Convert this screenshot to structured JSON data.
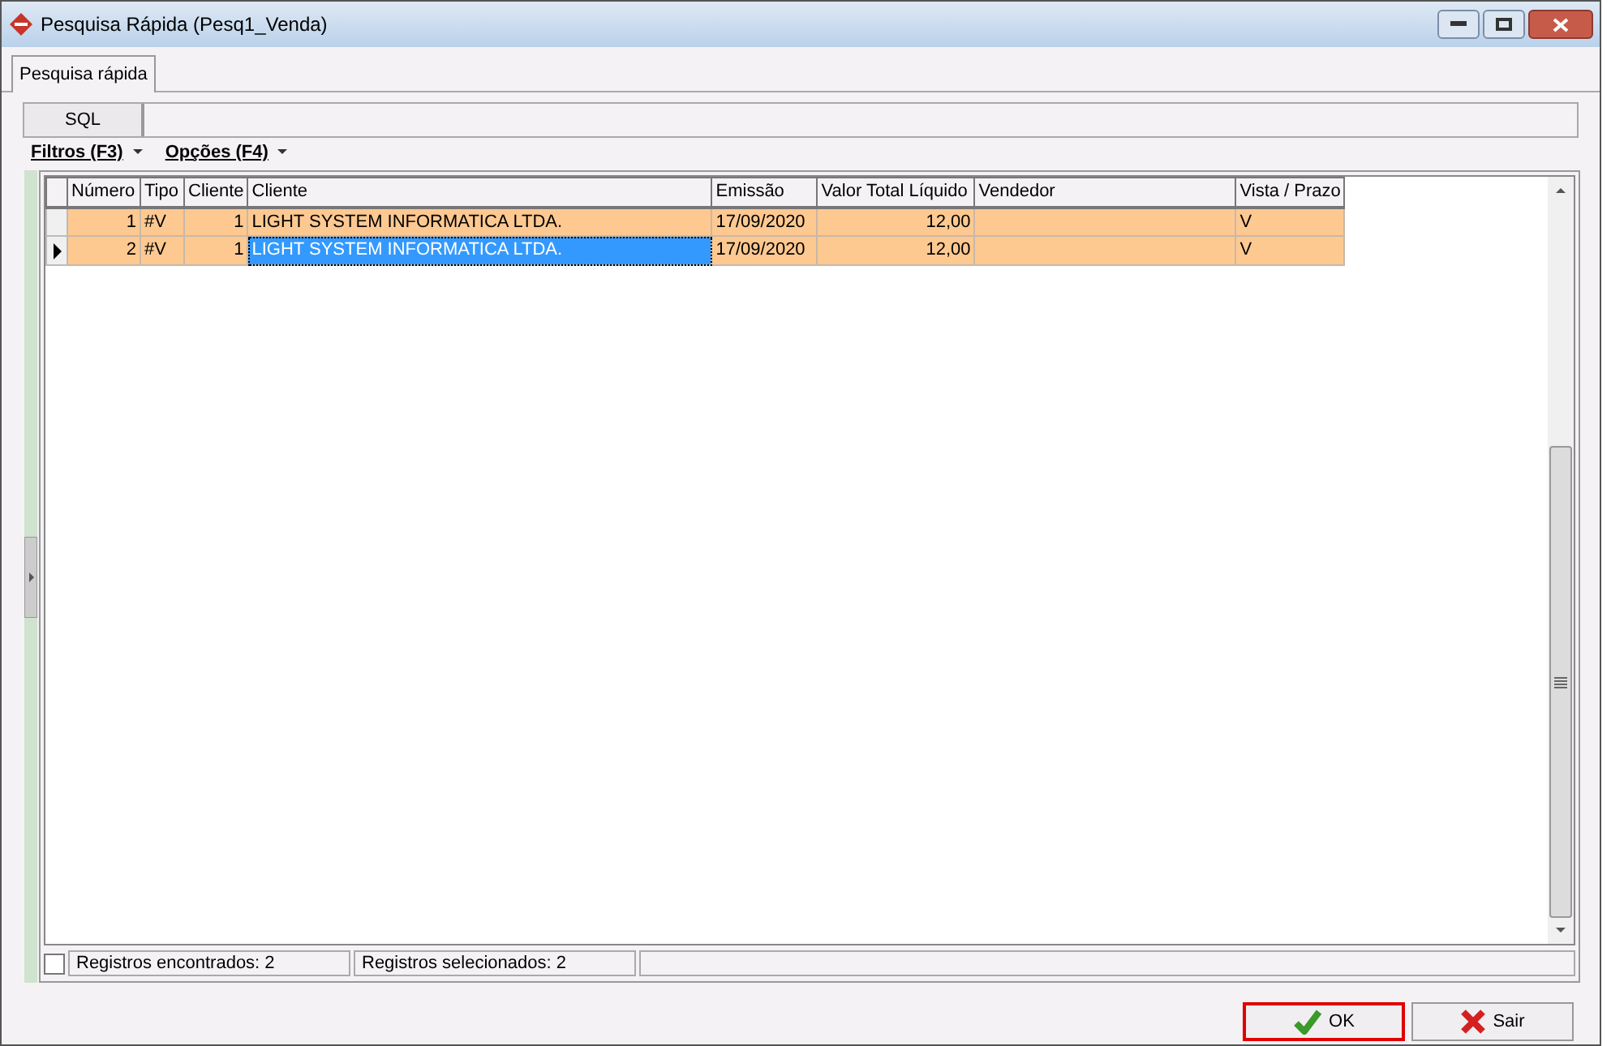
{
  "window": {
    "title": "Pesquisa Rápida (Pesq1_Venda)"
  },
  "tabs": [
    {
      "label": "Pesquisa rápida",
      "selected": true
    }
  ],
  "sql_button": "SQL",
  "menus": [
    {
      "label": "Filtros (F3)"
    },
    {
      "label": "Opções (F4)"
    }
  ],
  "table": {
    "columns": [
      "Número",
      "Tipo",
      "Cliente",
      "Cliente",
      "Emissão",
      "Valor Total Líquido",
      "Vendedor",
      "Vista / Prazo"
    ],
    "rows": [
      {
        "selected": false,
        "cells": [
          "1",
          "#V",
          "1",
          "LIGHT SYSTEM INFORMATICA LTDA.",
          "17/09/2020",
          "12,00",
          "",
          "V"
        ]
      },
      {
        "selected": true,
        "cells": [
          "2",
          "#V",
          "1",
          "LIGHT SYSTEM INFORMATICA LTDA.",
          "17/09/2020",
          "12,00",
          "",
          "V"
        ]
      }
    ]
  },
  "status_bar": {
    "checked": false,
    "fields": [
      "Registros encontrados: 2",
      "Registros selecionados: 2"
    ]
  },
  "buttons": [
    {
      "label": "OK",
      "kind": "ok",
      "highlighted": true
    },
    {
      "label": "Sair",
      "kind": "exit",
      "highlighted": false
    }
  ]
}
